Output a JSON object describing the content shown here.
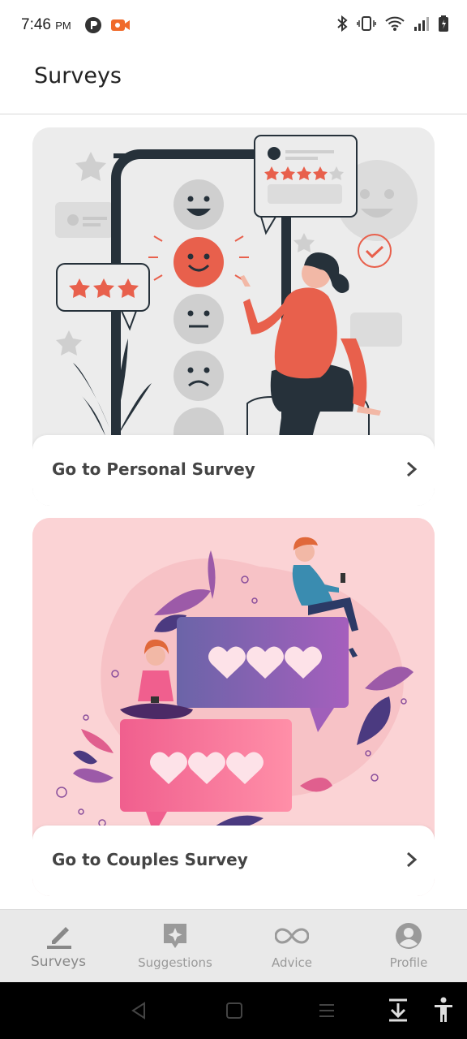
{
  "status_bar": {
    "time": "7:46",
    "ampm": "PM",
    "icons": [
      "p-app-icon",
      "video-record-icon",
      "bluetooth-icon",
      "vibrate-icon",
      "wifi-icon",
      "signal-icon",
      "battery-icon"
    ]
  },
  "header": {
    "title": "Surveys"
  },
  "cards": [
    {
      "label": "Go to Personal Survey",
      "image": "personal-survey-illustration"
    },
    {
      "label": "Go to Couples Survey",
      "image": "couples-survey-illustration"
    }
  ],
  "bottom_nav": {
    "items": [
      {
        "label": "Surveys",
        "icon": "pencil-icon",
        "active": true
      },
      {
        "label": "Suggestions",
        "icon": "sparkle-chat-icon",
        "active": false
      },
      {
        "label": "Advice",
        "icon": "infinity-icon",
        "active": false
      },
      {
        "label": "Profile",
        "icon": "profile-icon",
        "active": false
      }
    ]
  },
  "colors": {
    "accent_coral": "#e8604c",
    "personal_bg": "#ececec",
    "couples_bg": "#fbd3d5",
    "nav_bg": "#e9e9e9"
  }
}
